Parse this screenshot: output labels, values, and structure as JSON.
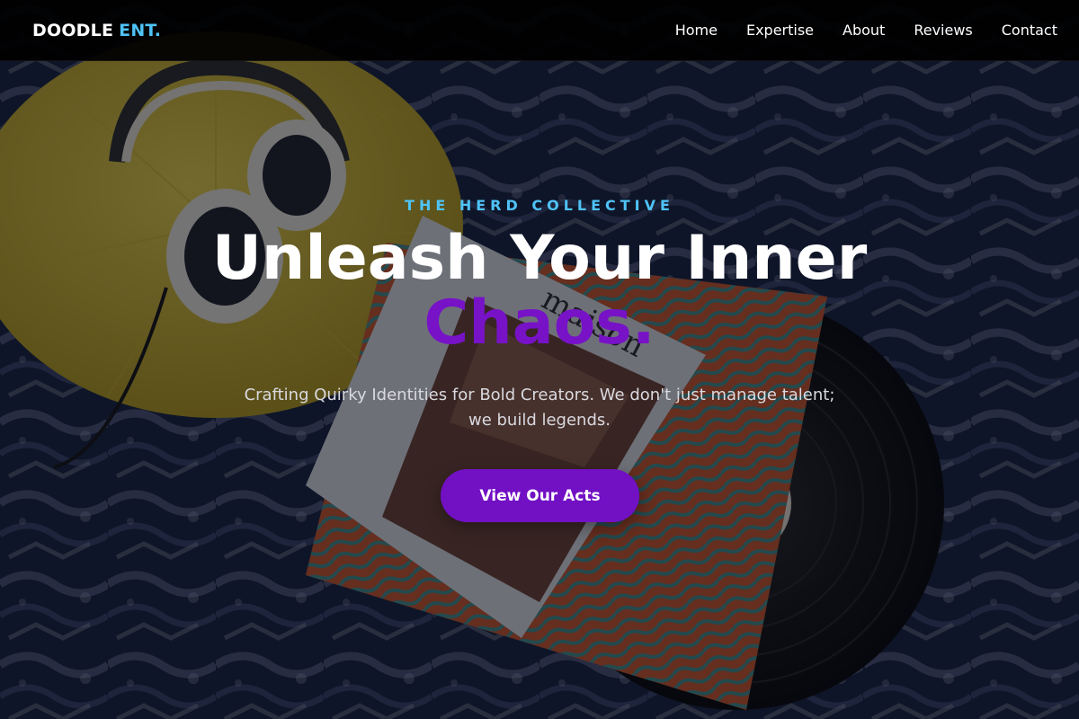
{
  "brand": {
    "name": "DOODLE",
    "accent": "ENT.",
    "accent_color": "#4fc3f7"
  },
  "nav": {
    "items": [
      {
        "label": "Home"
      },
      {
        "label": "Expertise"
      },
      {
        "label": "About"
      },
      {
        "label": "Reviews"
      },
      {
        "label": "Contact"
      }
    ]
  },
  "hero": {
    "eyebrow": "THE HERD COLLECTIVE",
    "headline_main": "Unleash Your Inner",
    "headline_accent": "Chaos.",
    "subtext": "Crafting Quirky Identities for Bold Creators. We don't just manage talent; we build legends.",
    "cta_label": "View Our Acts",
    "accent_color": "#7712c7",
    "background_icon": "headphones-vinyl-record-photo"
  },
  "colors": {
    "navbar_bg": "#000000",
    "cta_bg": "#7210c4",
    "text_primary": "#ffffff"
  }
}
